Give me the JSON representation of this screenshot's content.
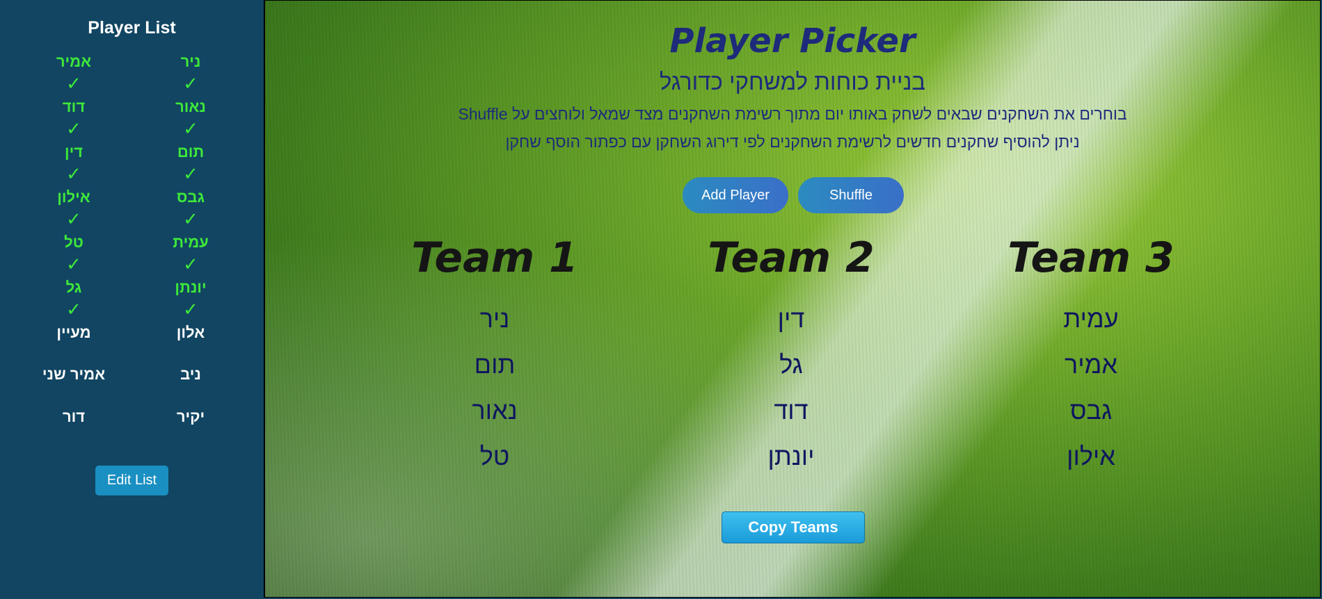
{
  "sidebar": {
    "title": "Player List",
    "players": [
      {
        "name": "ניר",
        "selected": true,
        "check": "✓"
      },
      {
        "name": "אמיר",
        "selected": true,
        "check": "✓"
      },
      {
        "name": "נאור",
        "selected": true,
        "check": "✓"
      },
      {
        "name": "דוד",
        "selected": true,
        "check": "✓"
      },
      {
        "name": "תום",
        "selected": true,
        "check": "✓"
      },
      {
        "name": "דין",
        "selected": true,
        "check": "✓"
      },
      {
        "name": "גבס",
        "selected": true,
        "check": "✓"
      },
      {
        "name": "אילון",
        "selected": true,
        "check": "✓"
      },
      {
        "name": "עמית",
        "selected": true,
        "check": "✓"
      },
      {
        "name": "טל",
        "selected": true,
        "check": "✓"
      },
      {
        "name": "יונתן",
        "selected": true,
        "check": "✓"
      },
      {
        "name": "גל",
        "selected": true,
        "check": "✓"
      },
      {
        "name": "אלון",
        "selected": false
      },
      {
        "name": "מעיין",
        "selected": false
      },
      {
        "name": "ניב",
        "selected": false
      },
      {
        "name": "אמיר שני",
        "selected": false
      },
      {
        "name": "יקיר",
        "selected": false
      },
      {
        "name": "דור",
        "selected": false
      }
    ],
    "edit_button": "Edit List"
  },
  "main": {
    "title": "Player Picker",
    "subtitle": "בניית כוחות למשחקי כדורגל",
    "desc_line1": "בוחרים את השחקנים שבאים לשחק באותו יום מתוך רשימת השחקנים מצד שמאל ולוחצים על Shuffle",
    "desc_line2": "ניתן להוסיף שחקנים חדשים לרשימת השחקנים לפי דירוג השחקן עם כפתור הוסף שחקן",
    "add_player_button": "Add Player",
    "shuffle_button": "Shuffle",
    "teams": [
      {
        "name": "Team 1",
        "players": [
          "ניר",
          "תום",
          "נאור",
          "טל"
        ]
      },
      {
        "name": "Team 2",
        "players": [
          "דין",
          "גל",
          "דוד",
          "יונתן"
        ]
      },
      {
        "name": "Team 3",
        "players": [
          "עמית",
          "אמיר",
          "גבס",
          "אילון"
        ]
      }
    ],
    "copy_button": "Copy Teams"
  },
  "colors": {
    "sidebar_bg": "#114562",
    "selected_player": "#3ee83a",
    "title_text": "#1d2b7a",
    "team_player_text": "#0f1660"
  }
}
